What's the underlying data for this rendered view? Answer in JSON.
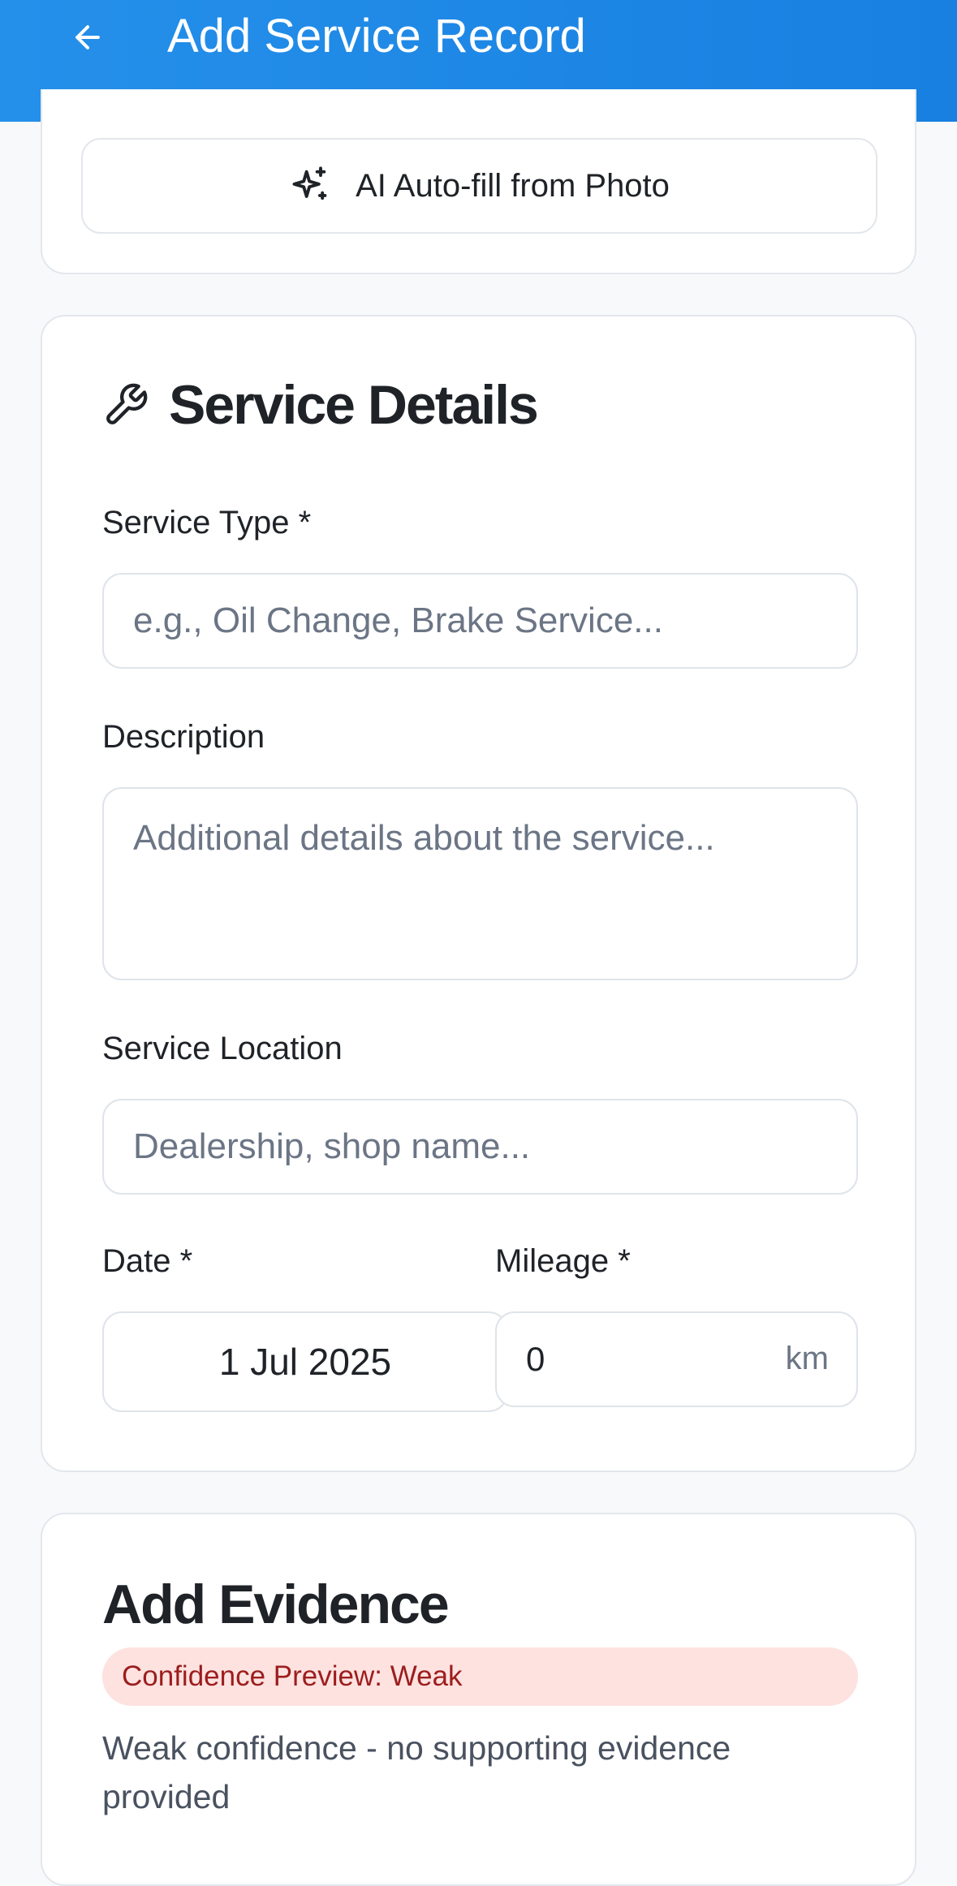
{
  "header": {
    "title": "Add Service Record",
    "background": "#1d88e6"
  },
  "ai_autofill": {
    "label": "AI Auto-fill from Photo"
  },
  "service_details": {
    "title": "Service Details",
    "service_type": {
      "label": "Service Type *",
      "placeholder": "e.g., Oil Change, Brake Service...",
      "value": ""
    },
    "description": {
      "label": "Description",
      "placeholder": "Additional details about the service...",
      "value": ""
    },
    "location": {
      "label": "Service Location",
      "placeholder": "Dealership, shop name...",
      "value": ""
    },
    "date": {
      "label": "Date *",
      "value": "1 Jul 2025"
    },
    "mileage": {
      "label": "Mileage *",
      "value": "0",
      "unit": "km"
    }
  },
  "evidence": {
    "title": "Add Evidence",
    "confidence_badge": "Confidence Preview: Weak",
    "confidence_description": "Weak confidence - no supporting evidence provided",
    "badge_color": "#fde2e0",
    "badge_text_color": "#9c1d1d"
  },
  "icons": {
    "back": "arrow-left-icon",
    "ai": "sparkles-icon",
    "section": "wrench-icon"
  }
}
